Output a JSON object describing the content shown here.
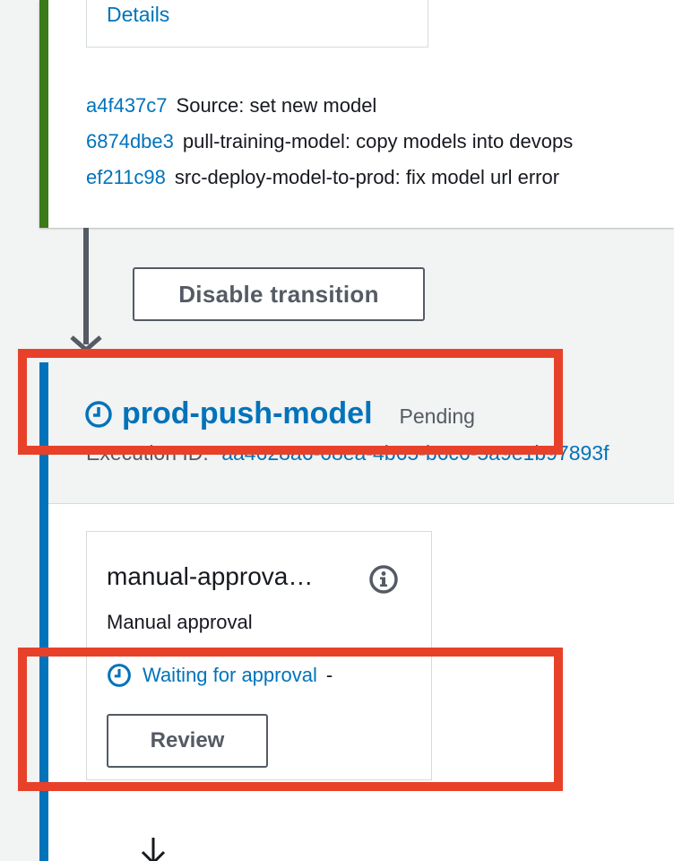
{
  "upper_stage": {
    "details_label": "Details",
    "commits": [
      {
        "hash": "a4f437c7",
        "message": "Source: set new model"
      },
      {
        "hash": "6874dbe3",
        "message": "pull-training-model: copy models into devops"
      },
      {
        "hash": "ef211c98",
        "message": "src-deploy-model-to-prod: fix model url error"
      }
    ],
    "status_color": "#3b7a16"
  },
  "transition": {
    "disable_label": "Disable transition"
  },
  "lower_stage": {
    "name": "prod-push-model",
    "status": "Pending",
    "execution_label": "Execution ID:",
    "execution_id": "aa4628a6-68ea-4b65-b6c6-5a9e1b97893f",
    "status_color": "#0073bb",
    "action": {
      "name": "manual-approva…",
      "provider": "Manual approval",
      "status_text": "Waiting for approval",
      "separator": "-",
      "review_label": "Review"
    }
  },
  "annotations": {
    "highlight_color": "#e8412a"
  },
  "icons": [
    "clock-icon",
    "info-icon",
    "down-arrow-icon"
  ]
}
